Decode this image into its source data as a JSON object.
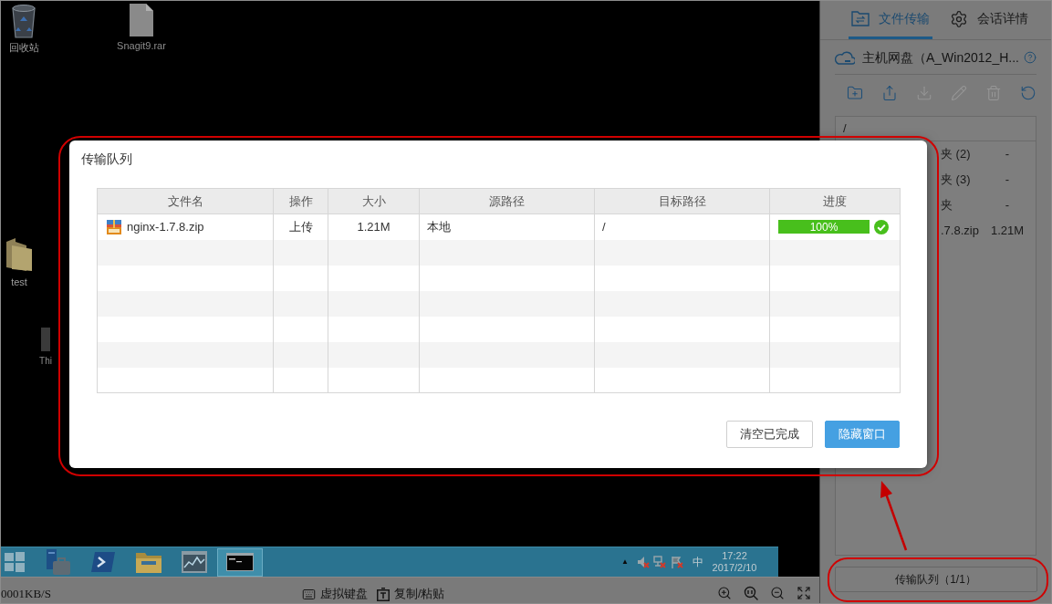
{
  "desktop": {
    "icons": [
      {
        "kind": "recycle-bin",
        "label": "回收站"
      },
      {
        "kind": "file",
        "label": "Snagit9.rar"
      },
      {
        "kind": "folder",
        "label": "test"
      },
      {
        "kind": "app",
        "label": "Thi"
      }
    ]
  },
  "taskbar": {
    "buttons": [
      {
        "kind": "start",
        "selected": false
      },
      {
        "kind": "server",
        "selected": false
      },
      {
        "kind": "shell",
        "selected": false
      },
      {
        "kind": "folder",
        "selected": false
      },
      {
        "kind": "monitor",
        "selected": false
      },
      {
        "kind": "console",
        "selected": true
      }
    ],
    "tray": {
      "overflow": "▲",
      "ime": "中",
      "time": "17:22",
      "date": "2017/2/10"
    }
  },
  "remote_toolbar": {
    "speed": "0001KB/S",
    "actions": [
      {
        "kind": "keyboard",
        "label": "虚拟键盘"
      },
      {
        "kind": "clipboard",
        "label": "复制/粘贴"
      }
    ]
  },
  "side_panel": {
    "tabs": [
      {
        "kind": "transfer",
        "label": "文件传输",
        "selected": true
      },
      {
        "kind": "session",
        "label": "会话详情",
        "selected": false
      }
    ],
    "drive": {
      "title": "主机网盘（A_Win2012_H..."
    },
    "tools": [
      {
        "kind": "new-folder",
        "disabled": false
      },
      {
        "kind": "upload",
        "disabled": false
      },
      {
        "kind": "download",
        "disabled": true
      },
      {
        "kind": "rename",
        "disabled": true
      },
      {
        "kind": "delete",
        "disabled": true
      },
      {
        "kind": "refresh",
        "disabled": false
      }
    ],
    "path": "/",
    "files": [
      {
        "name": "夹 (2)",
        "size": "-"
      },
      {
        "name": "夹 (3)",
        "size": "-"
      },
      {
        "name": "夹",
        "size": "-"
      },
      {
        "name": ".7.8.zip",
        "size": "1.21M"
      }
    ],
    "queue_button": "传输队列（1/1）"
  },
  "transfer_dialog": {
    "title": "传输队列",
    "columns": [
      "文件名",
      "操作",
      "大小",
      "源路径",
      "目标路径",
      "进度"
    ],
    "rows": [
      {
        "name": "nginx-1.7.8.zip",
        "action": "上传",
        "size": "1.21M",
        "source": "本地",
        "target": "/",
        "progress": {
          "level": 1,
          "label": "100%",
          "done": true
        }
      }
    ],
    "buttons": [
      {
        "kind": "secondary",
        "label": "清空已完成"
      },
      {
        "kind": "primary",
        "label": "隐藏窗口"
      }
    ]
  }
}
